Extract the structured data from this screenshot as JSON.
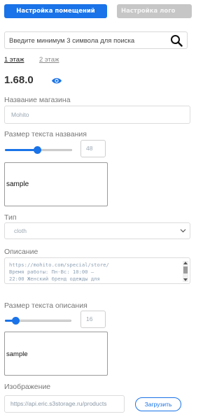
{
  "tabs": [
    {
      "label": "Настройка помещений",
      "active": true
    },
    {
      "label": "Настройка лого",
      "active": false
    }
  ],
  "search": {
    "placeholder": "Введите минимум 3 символа для поиска",
    "value": ""
  },
  "floors": [
    {
      "label": "1 этаж",
      "active": true
    },
    {
      "label": "2 этаж",
      "active": false
    }
  ],
  "version": "1.68.0",
  "store_name": {
    "label": "Название магазина",
    "value": "Mohito"
  },
  "name_size": {
    "label": "Размер текста названия",
    "value": "48",
    "slider_fraction": 0.48
  },
  "name_sample": {
    "text": "sample"
  },
  "type": {
    "label": "Тип",
    "value": "cloth"
  },
  "description": {
    "label": "Описание",
    "value": "https://mohito.com/special/store/\nВремя работы: Пн-Вс: 10:00 –\n22:00 Женский бренд одежды для\nтех, кто любит элегантные модели"
  },
  "desc_size": {
    "label": "Размер текста описания",
    "value": "16",
    "slider_fraction": 0.16
  },
  "desc_sample": {
    "text": "sample"
  },
  "image": {
    "label": "Изображение",
    "value": "https://api.eric.s3storage.ru/products",
    "upload_label": "Загрузить"
  },
  "colors": {
    "accent": "#1a73e8",
    "inactive_tab": "#c6c6c6",
    "muted_text": "#777777"
  }
}
